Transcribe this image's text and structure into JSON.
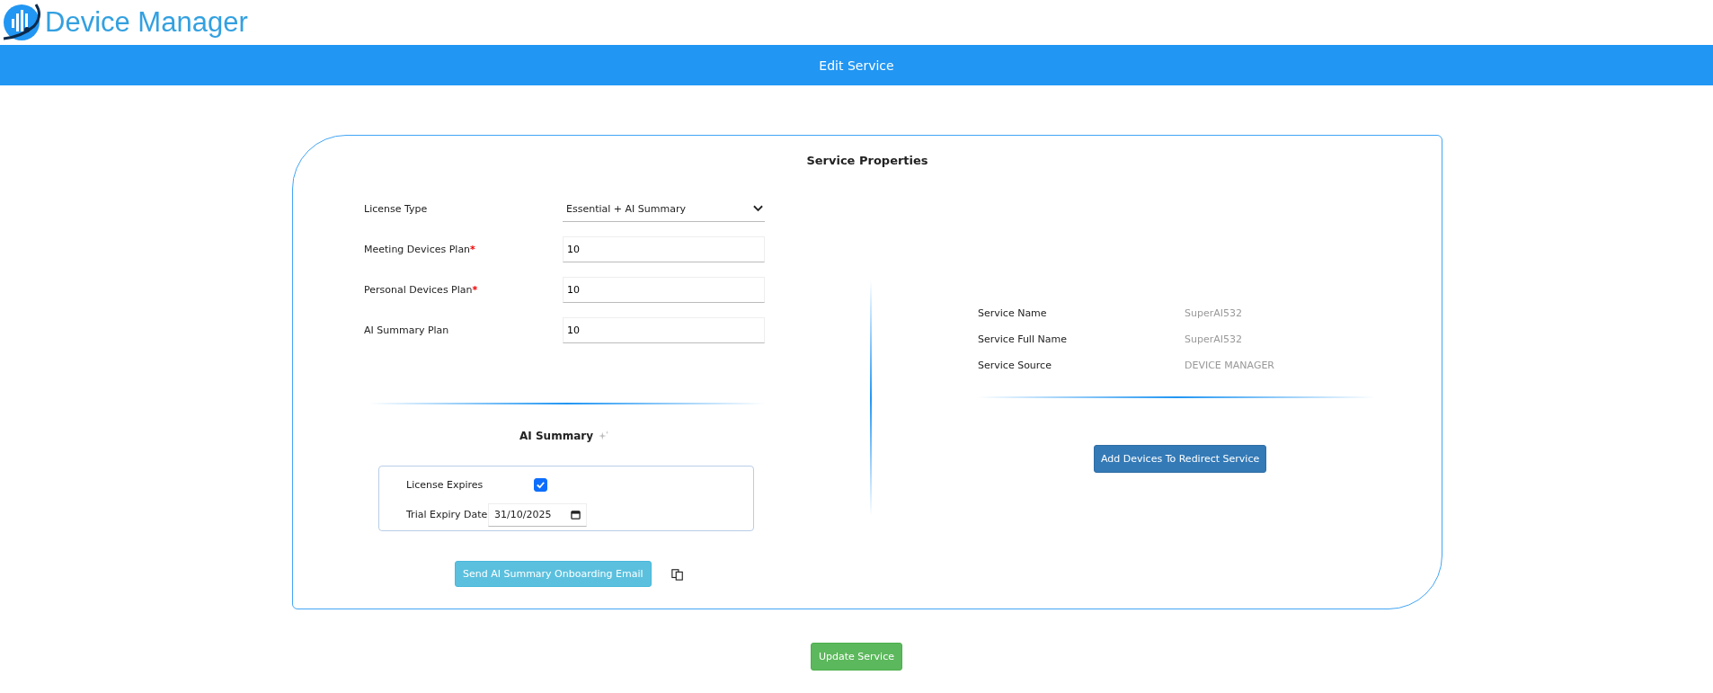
{
  "app": {
    "title": "Device Manager"
  },
  "header": {
    "title": "Edit Service"
  },
  "card": {
    "title": "Service Properties"
  },
  "fields": [
    {
      "kind": "select",
      "label": "License Type",
      "value": "Essential + AI Summary"
    },
    {
      "kind": "input",
      "label": "Meeting Devices Plan",
      "required_mark": "*",
      "value": "10"
    },
    {
      "kind": "input",
      "label": "Personal Devices Plan",
      "required_mark": "*",
      "value": "10"
    },
    {
      "kind": "input",
      "label": "AI Summary Plan",
      "value": "10"
    }
  ],
  "ai_summary": {
    "title": "AI Summary",
    "license_expires": {
      "label": "License Expires",
      "checked": true
    },
    "trial_expiry": {
      "label": "Trial Expiry Date",
      "value": "31/10/2025"
    },
    "send_button": "Send AI Summary Onboarding Email"
  },
  "service_info": [
    {
      "label": "Service Name",
      "value": "SuperAI532"
    },
    {
      "label": "Service Full Name",
      "value": "SuperAI532"
    },
    {
      "label": "Service Source",
      "value": "DEVICE MANAGER"
    }
  ],
  "add_devices_button": "Add Devices To Redirect Service",
  "update_button": "Update Service"
}
